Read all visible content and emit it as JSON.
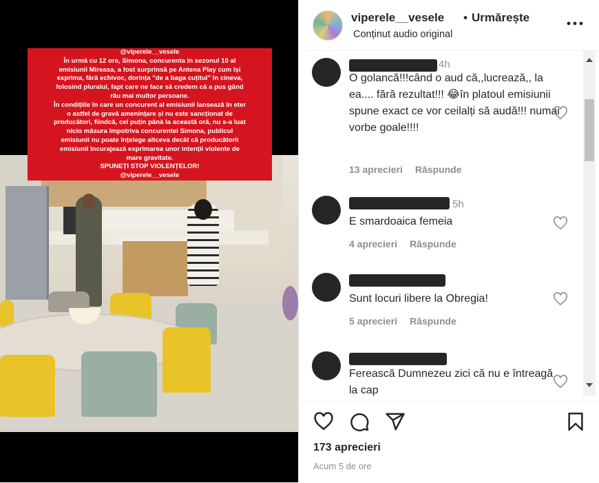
{
  "media": {
    "caption_lines": [
      "@viperele__vesele",
      "În urmă cu 12 ore, Simona, concurenta în sezonul 10 al",
      "emisiunii Mireasa, a fost surprinsă pe Antena Play cum își",
      "exprima, fără echivoc, dorința \"de a baga cuțitul\" în cineva,",
      "folosind pluralul, fapt care ne face să credem că a pus gând",
      "rău mai multor persoane.",
      "În condițiile în care un concurent al emisiunii lansează în eter",
      "o astfel de gravă amenințare și nu este sancționat de",
      "producători, fiindcă, cel puțin până la această oră, nu s-a luat",
      "nicio măsura împotriva concurentei Simona, publicul",
      "emisiunii nu poate înțelege altceva decât că producătorii",
      "emisiunii încurajează exprimarea unor intenții violente de",
      "mare gravitate.",
      "SPUNEȚI STOP VIOLENȚELOR!",
      "@viperele__vesele"
    ]
  },
  "header": {
    "username": "viperele__vesele",
    "separator": "•",
    "follow_label": "Urmărește",
    "audio_label": "Conținut audio original",
    "more_icon": "more-icon"
  },
  "comments": [
    {
      "time": "4h",
      "text": "O golancă!!!când o aud că,,lucrează,, la ea.... fără rezultat!!! 😂în platoul emisiunii spune exact ce vor ceilalți să audă!!! numai vorbe goale!!!!",
      "likes": "13 aprecieri",
      "reply": "Răspunde"
    },
    {
      "time": "5h",
      "text": "E smardoaica femeia",
      "likes": "4 aprecieri",
      "reply": "Răspunde"
    },
    {
      "time": "",
      "text": "Sunt locuri libere la Obregia!",
      "likes": "5 aprecieri",
      "reply": "Răspunde"
    },
    {
      "time": "",
      "text": "Ferească Dumnezeu zici că nu e întreagă la cap",
      "likes": "",
      "reply": ""
    }
  ],
  "actions": {
    "likes_count": "173 aprecieri",
    "posted_ago": "Acum 5 de ore",
    "icons": [
      "heart-icon",
      "comment-icon",
      "share-icon",
      "bookmark-icon"
    ]
  }
}
